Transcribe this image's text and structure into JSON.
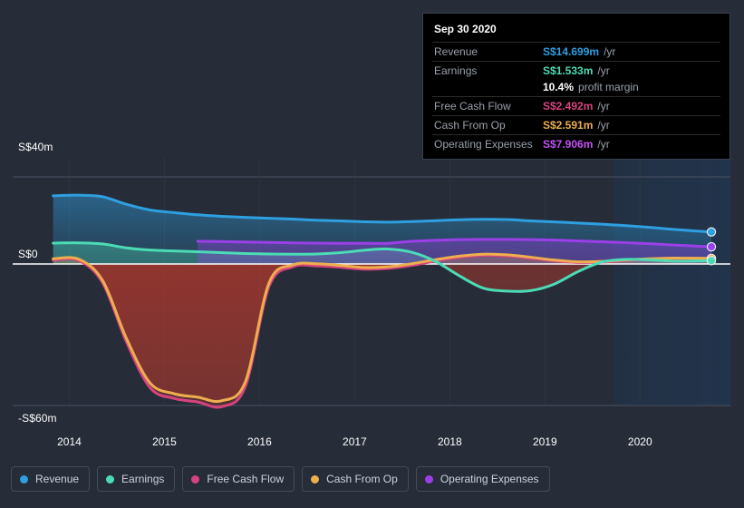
{
  "chart_data": {
    "type": "area",
    "title": "",
    "xlabel": "",
    "ylabel": "",
    "currency_prefix": "S$",
    "ylim": [
      -68,
      40
    ],
    "xlim": [
      2013.7,
      2020.95
    ],
    "grid": true,
    "legend_position": "bottom-left",
    "y_ticks": [
      {
        "value": 40,
        "label": "S$40m"
      },
      {
        "value": 0,
        "label": "S$0"
      },
      {
        "value": -60,
        "label": "-S$60m"
      }
    ],
    "x_ticks": [
      {
        "value": 2014,
        "label": "2014"
      },
      {
        "value": 2015,
        "label": "2015"
      },
      {
        "value": 2016,
        "label": "2016"
      },
      {
        "value": 2017,
        "label": "2017"
      },
      {
        "value": 2018,
        "label": "2018"
      },
      {
        "value": 2019,
        "label": "2019"
      },
      {
        "value": 2020,
        "label": "2020"
      }
    ],
    "forecast_start": 2019.72,
    "x": [
      2013.83,
      2014.1,
      2014.35,
      2014.6,
      2014.85,
      2015.1,
      2015.35,
      2015.6,
      2015.85,
      2016.1,
      2016.35,
      2016.6,
      2016.85,
      2017.1,
      2017.35,
      2017.6,
      2017.85,
      2018.1,
      2018.35,
      2018.6,
      2018.85,
      2019.1,
      2019.35,
      2019.6,
      2019.85,
      2020.1,
      2020.35,
      2020.6,
      2020.75
    ],
    "series": [
      {
        "name": "Revenue",
        "key": "revenue",
        "color": "#2e9fe0",
        "values": [
          31.3,
          31.6,
          30.9,
          27.4,
          24.8,
          23.6,
          22.6,
          21.9,
          21.4,
          21.0,
          20.6,
          20.1,
          19.8,
          19.4,
          19.2,
          19.5,
          19.9,
          20.3,
          20.5,
          20.4,
          19.8,
          19.3,
          18.8,
          18.3,
          17.6,
          16.8,
          15.9,
          15.1,
          14.699
        ]
      },
      {
        "name": "Earnings",
        "key": "earnings",
        "color": "#4bdcb5",
        "values": [
          9.6,
          9.7,
          9.2,
          7.4,
          6.4,
          6.0,
          5.6,
          5.2,
          4.8,
          4.6,
          4.5,
          4.6,
          5.2,
          6.3,
          6.9,
          5.4,
          1.2,
          -5.0,
          -10.2,
          -11.5,
          -11.3,
          -8.5,
          -3.2,
          0.9,
          2.1,
          1.9,
          1.3,
          1.4,
          1.533
        ]
      },
      {
        "name": "Free Cash Flow",
        "key": "free_cash_flow",
        "color": "#d6437f",
        "values": [
          1.8,
          1.5,
          -8.0,
          -33.0,
          -52.5,
          -57.0,
          -58.5,
          -60.5,
          -52.0,
          -9.5,
          -1.2,
          -0.8,
          -1.4,
          -2.2,
          -1.9,
          -0.6,
          1.4,
          3.0,
          4.0,
          3.7,
          2.6,
          1.4,
          0.7,
          0.9,
          1.6,
          2.2,
          2.5,
          2.5,
          2.492
        ]
      },
      {
        "name": "Cash From Op",
        "key": "cash_from_op",
        "color": "#eeae4e",
        "values": [
          2.4,
          2.2,
          -7.0,
          -31.5,
          -50.5,
          -55.0,
          -56.5,
          -58.0,
          -50.0,
          -8.0,
          -0.4,
          0.1,
          -0.6,
          -1.5,
          -1.2,
          0.1,
          2.0,
          3.6,
          4.5,
          4.2,
          3.1,
          1.8,
          1.0,
          1.2,
          1.9,
          2.4,
          2.7,
          2.65,
          2.591
        ]
      },
      {
        "name": "Operating Expenses",
        "key": "operating_expenses",
        "color": "#9b3fe8",
        "values": [
          null,
          null,
          null,
          null,
          null,
          null,
          10.4,
          10.3,
          10.1,
          9.9,
          9.7,
          9.6,
          9.5,
          9.5,
          9.5,
          10.4,
          10.9,
          11.2,
          11.3,
          11.3,
          11.2,
          11.0,
          10.6,
          10.2,
          9.8,
          9.3,
          8.7,
          8.2,
          7.906
        ]
      }
    ]
  },
  "axis": {
    "y_top_label": "S$40m",
    "y_zero_label": "S$0",
    "y_bottom_label": "-S$60m"
  },
  "legend": {
    "items": [
      {
        "label": "Revenue",
        "color": "#2e9fe0"
      },
      {
        "label": "Earnings",
        "color": "#4bdcb5"
      },
      {
        "label": "Free Cash Flow",
        "color": "#d6437f"
      },
      {
        "label": "Cash From Op",
        "color": "#eeae4e"
      },
      {
        "label": "Operating Expenses",
        "color": "#9b3fe8"
      }
    ]
  },
  "tooltip": {
    "date": "Sep 30 2020",
    "rows": [
      {
        "key": "Revenue",
        "value": "S$14.699m",
        "unit": "/yr",
        "color": "#2e9fe0"
      },
      {
        "key": "Earnings",
        "value": "S$1.533m",
        "unit": "/yr",
        "color": "#4bdcb5"
      },
      {
        "key": "Free Cash Flow",
        "value": "S$2.492m",
        "unit": "/yr",
        "color": "#d6437f"
      },
      {
        "key": "Cash From Op",
        "value": "S$2.591m",
        "unit": "/yr",
        "color": "#eeae4e"
      },
      {
        "key": "Operating Expenses",
        "value": "S$7.906m",
        "unit": "/yr",
        "color": "#c44ff5"
      }
    ],
    "profit_margin_value": "10.4%",
    "profit_margin_label": "profit margin"
  }
}
